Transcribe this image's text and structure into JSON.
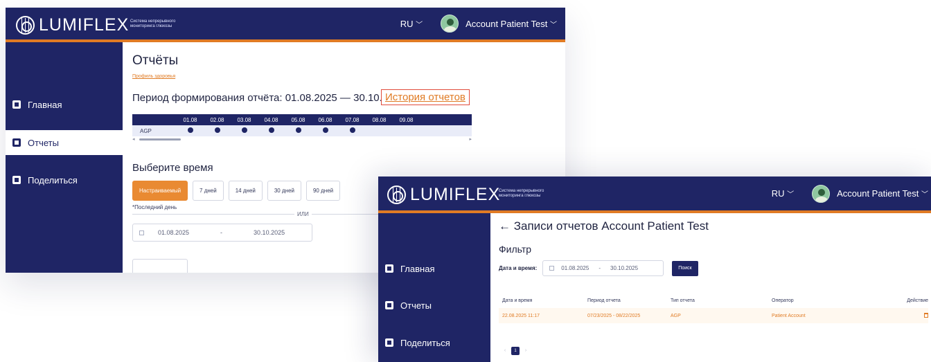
{
  "brand": {
    "name": "LUMIFLEX",
    "tagline": "Система непрерывного мониторинга глюкозы"
  },
  "header": {
    "language": "RU",
    "user": "Account Patient Test"
  },
  "nav": {
    "home": "Главная",
    "reports": "Отчеты",
    "share": "Поделиться"
  },
  "reports_page": {
    "title": "Отчёты",
    "breadcrumb": "Профиль здоровья",
    "period_text": "Период формирования отчёта: 01.08.2025 — 30.10.2025",
    "history_link": "История отчетов",
    "agp_table": {
      "row_label": "AGP",
      "dates": [
        "01.08",
        "02.08",
        "03.08",
        "04.08",
        "05.08",
        "06.08",
        "07.08",
        "08.08",
        "09.08"
      ],
      "has_report": [
        true,
        true,
        true,
        true,
        true,
        true,
        true,
        false,
        false
      ]
    },
    "time_heading": "Выберите время",
    "range_buttons": [
      "Настраиваемый",
      "7 дней",
      "14 дней",
      "30 дней",
      "90 дней"
    ],
    "selected_range": "Настраиваемый",
    "last_day_note": "*Последний день",
    "or_text": "ИЛИ",
    "date_from": "01.08.2025",
    "date_sep": "-",
    "date_to": "30.10.2025"
  },
  "history_page": {
    "title": "← Записи отчетов Account Patient Test",
    "filter_heading": "Фильтр",
    "filter_label": "Дата и время:",
    "date_from": "01.08.2025",
    "date_sep": "-",
    "date_to": "30.10.2025",
    "search_button": "Поиск",
    "columns": [
      "Дата и время",
      "Период отчета",
      "Тип отчета",
      "Оператор",
      "Действие"
    ],
    "rows": [
      [
        "22.08.2025 11:17",
        "07/23/2025 - 08/22/2025",
        "AGP",
        "Patient Account"
      ]
    ],
    "pager": {
      "prev": "‹",
      "current": "1",
      "next": "›"
    }
  },
  "colors": {
    "navy": "#1f2565",
    "accent": "#e07b24",
    "highlight_border": "#e14b3b"
  }
}
